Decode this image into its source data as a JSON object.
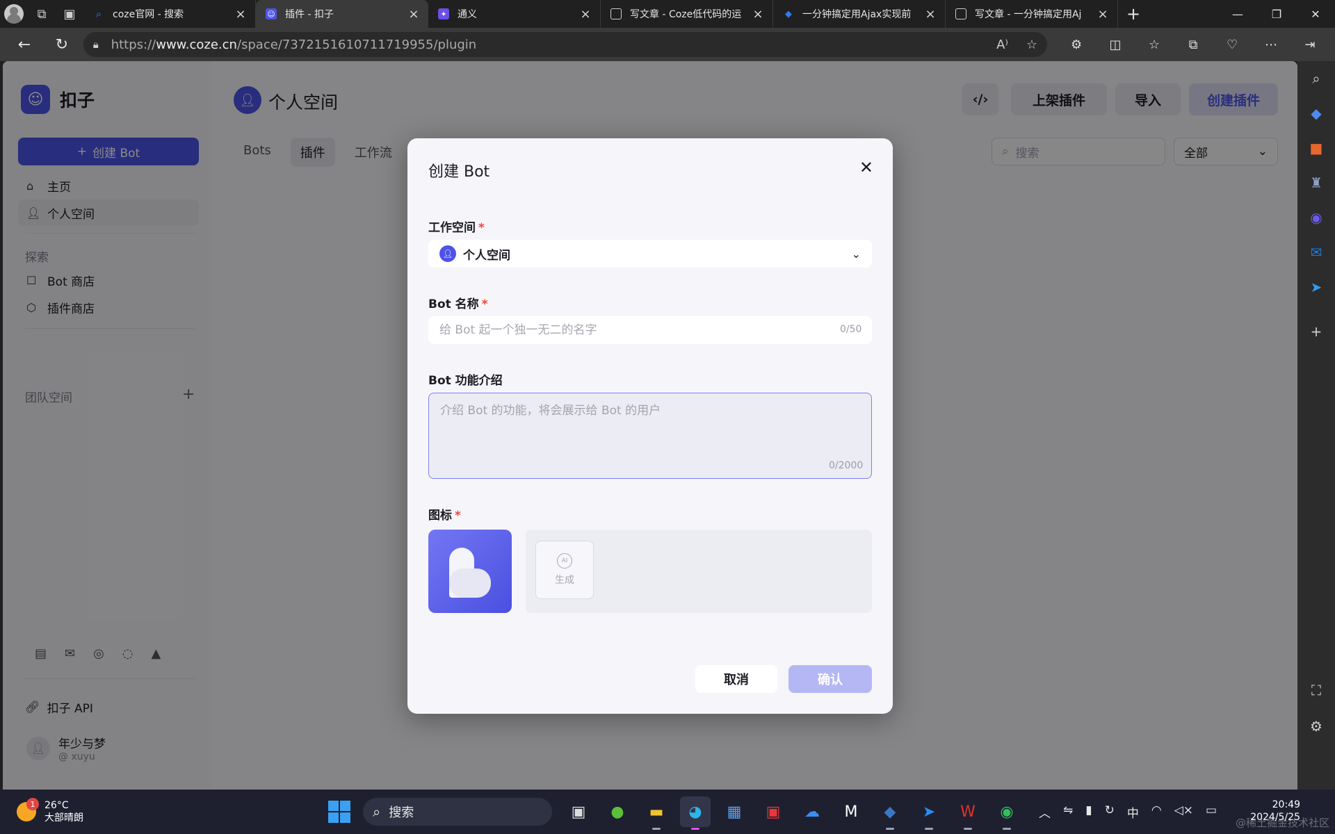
{
  "browser": {
    "tabs": [
      {
        "title": "coze官网 - 搜索",
        "favicon": "search-icon",
        "color": "#2b7bf4"
      },
      {
        "title": "插件 - 扣子",
        "favicon": "coze-icon",
        "color": "#4d53e8",
        "active": true
      },
      {
        "title": "通义",
        "favicon": "tongyi-icon",
        "color": "#6b4de8"
      },
      {
        "title": "写文章 - Coze低代码的运",
        "favicon": "document-icon",
        "color": "#cccccc"
      },
      {
        "title": "一分钟搞定用Ajax实现前",
        "favicon": "juejin-icon",
        "color": "#2b7bf4"
      },
      {
        "title": "写文章 - 一分钟搞定用Aj",
        "favicon": "document-icon",
        "color": "#cccccc"
      }
    ],
    "url_prefix": "https://",
    "url_domain": "www.coze.cn",
    "url_path": "/space/7372151610711719955/plugin"
  },
  "sidebar": {
    "brand": "扣子",
    "create_bot": "创建 Bot",
    "home": "主页",
    "personal_space": "个人空间",
    "explore_label": "探索",
    "bot_store": "Bot 商店",
    "plugin_store": "插件商店",
    "team_space_label": "团队空间",
    "api": "扣子 API",
    "user_name": "年少与梦",
    "user_handle": "@ xuyu"
  },
  "main": {
    "title": "个人空间",
    "tabs": [
      "Bots",
      "插件",
      "工作流"
    ],
    "active_tab": "插件",
    "btn_publish": "上架插件",
    "btn_import": "导入",
    "btn_create_plugin": "创建插件",
    "search_placeholder": "搜索",
    "filter_value": "全部"
  },
  "modal": {
    "title": "创建 Bot",
    "workspace_label": "工作空间",
    "workspace_value": "个人空间",
    "name_label": "Bot 名称",
    "name_placeholder": "给 Bot 起一个独一无二的名字",
    "name_counter": "0/50",
    "desc_label": "Bot 功能介绍",
    "desc_placeholder": "介绍 Bot 的功能，将会展示给 Bot 的用户",
    "desc_counter": "0/2000",
    "icon_label": "图标",
    "generate_label": "生成",
    "ai_badge": "AI",
    "cancel": "取消",
    "confirm": "确认",
    "required_mark": "*"
  },
  "taskbar": {
    "temperature": "26°C",
    "weather": "大部晴朗",
    "weather_badge": "1",
    "search": "搜索",
    "time": "20:49",
    "date": "2024/5/25",
    "ime": "中",
    "watermark": "@稀土掘金技术社区"
  },
  "colors": {
    "brand": "#4d53e8",
    "required": "#f0453c",
    "confirm_disabled": "#b5b7f5"
  }
}
